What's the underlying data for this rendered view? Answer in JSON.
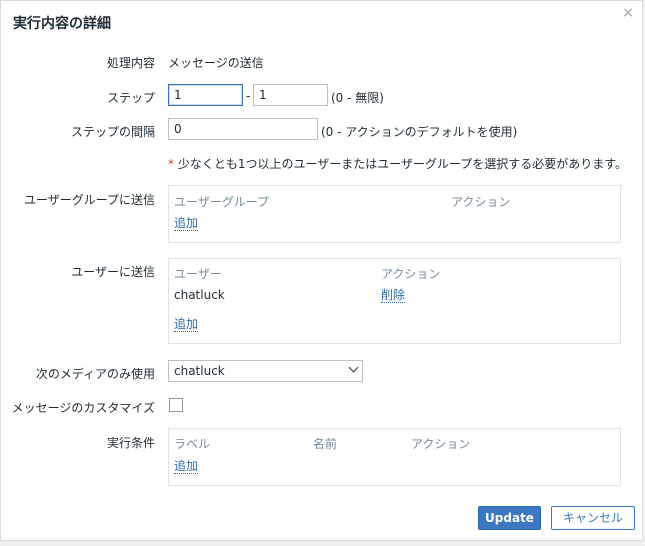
{
  "dialog": {
    "title": "実行内容の詳細",
    "close_icon": "×"
  },
  "operation": {
    "label": "処理内容",
    "value": "メッセージの送信"
  },
  "steps": {
    "label": "ステップ",
    "from": "1",
    "sep": "-",
    "to": "1",
    "hint": "(0 - 無限)"
  },
  "step_duration": {
    "label": "ステップの間隔",
    "value": "0",
    "hint": "(0 - アクションのデフォルトを使用)"
  },
  "required_note": {
    "star": "*",
    "text": "少なくとも1つ以上のユーザーまたはユーザーグループを選択する必要があります。"
  },
  "send_to_groups": {
    "label": "ユーザーグループに送信",
    "col_group": "ユーザーグループ",
    "col_action": "アクション",
    "add": "追加"
  },
  "send_to_users": {
    "label": "ユーザーに送信",
    "col_user": "ユーザー",
    "col_action": "アクション",
    "rows": [
      {
        "user": "chatluck",
        "action": "削除"
      }
    ],
    "add": "追加"
  },
  "media": {
    "label": "次のメディアのみ使用",
    "selected": "chatluck"
  },
  "custom_message": {
    "label": "メッセージのカスタマイズ",
    "checked": false
  },
  "conditions": {
    "label": "実行条件",
    "col_label": "ラベル",
    "col_name": "名前",
    "col_action": "アクション",
    "add": "追加"
  },
  "buttons": {
    "update": "Update",
    "cancel": "キャンセル"
  },
  "colors": {
    "primary": "#3b78c0",
    "link": "#2f6ca7",
    "required": "#d64040"
  }
}
